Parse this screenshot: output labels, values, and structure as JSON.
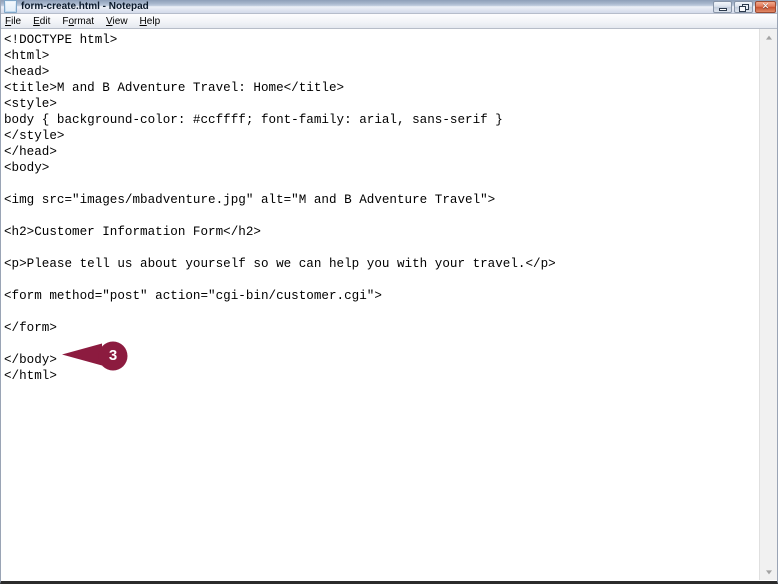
{
  "window": {
    "title": "form-create.html - Notepad",
    "icon": "notepad-document-icon",
    "controls": {
      "minimize_label": "Minimize",
      "restore_label": "Restore",
      "close_label": "Close",
      "close_glyph": "✕"
    },
    "close_button_color": "#c7502f",
    "titlebar_gradient_top": "#8e9fb8",
    "titlebar_gradient_bottom": "#d3daea"
  },
  "menubar": {
    "items": [
      {
        "label": "File",
        "pre": "",
        "accel": "F",
        "post": "ile"
      },
      {
        "label": "Edit",
        "pre": "",
        "accel": "E",
        "post": "dit"
      },
      {
        "label": "Format",
        "pre": "F",
        "accel": "o",
        "post": "rmat"
      },
      {
        "label": "View",
        "pre": "",
        "accel": "V",
        "post": "iew"
      },
      {
        "label": "Help",
        "pre": "",
        "accel": "H",
        "post": "elp"
      }
    ]
  },
  "editor": {
    "content": "<!DOCTYPE html>\n<html>\n<head>\n<title>M and B Adventure Travel: Home</title>\n<style>\nbody { background-color: #ccffff; font-family: arial, sans-serif }\n</style>\n</head>\n<body>\n\n<img src=\"images/mbadventure.jpg\" alt=\"M and B Adventure Travel\">\n\n<h2>Customer Information Form</h2>\n\n<p>Please tell us about yourself so we can help you with your travel.</p>\n\n<form method=\"post\" action=\"cgi-bin/customer.cgi\">\n\n</form>\n\n</body>\n</html>",
    "lines": [
      "<!DOCTYPE html>",
      "<html>",
      "<head>",
      "<title>M and B Adventure Travel: Home</title>",
      "<style>",
      "body { background-color: #ccffff; font-family: arial, sans-serif }",
      "</style>",
      "</head>",
      "<body>",
      "",
      "<img src=\"images/mbadventure.jpg\" alt=\"M and B Adventure Travel\">",
      "",
      "<h2>Customer Information Form</h2>",
      "",
      "<p>Please tell us about yourself so we can help you with your travel.</p>",
      "",
      "<form method=\"post\" action=\"cgi-bin/customer.cgi\">",
      "",
      "</form>",
      "",
      "</body>",
      "</html>"
    ]
  },
  "scrollbar": {
    "up_arrow": "scroll-up-arrow-icon",
    "down_arrow": "scroll-down-arrow-icon",
    "track_color": "#f1f1f1"
  },
  "callout": {
    "number": "3",
    "color": "#8c1b3f",
    "points_to": "</form>"
  }
}
